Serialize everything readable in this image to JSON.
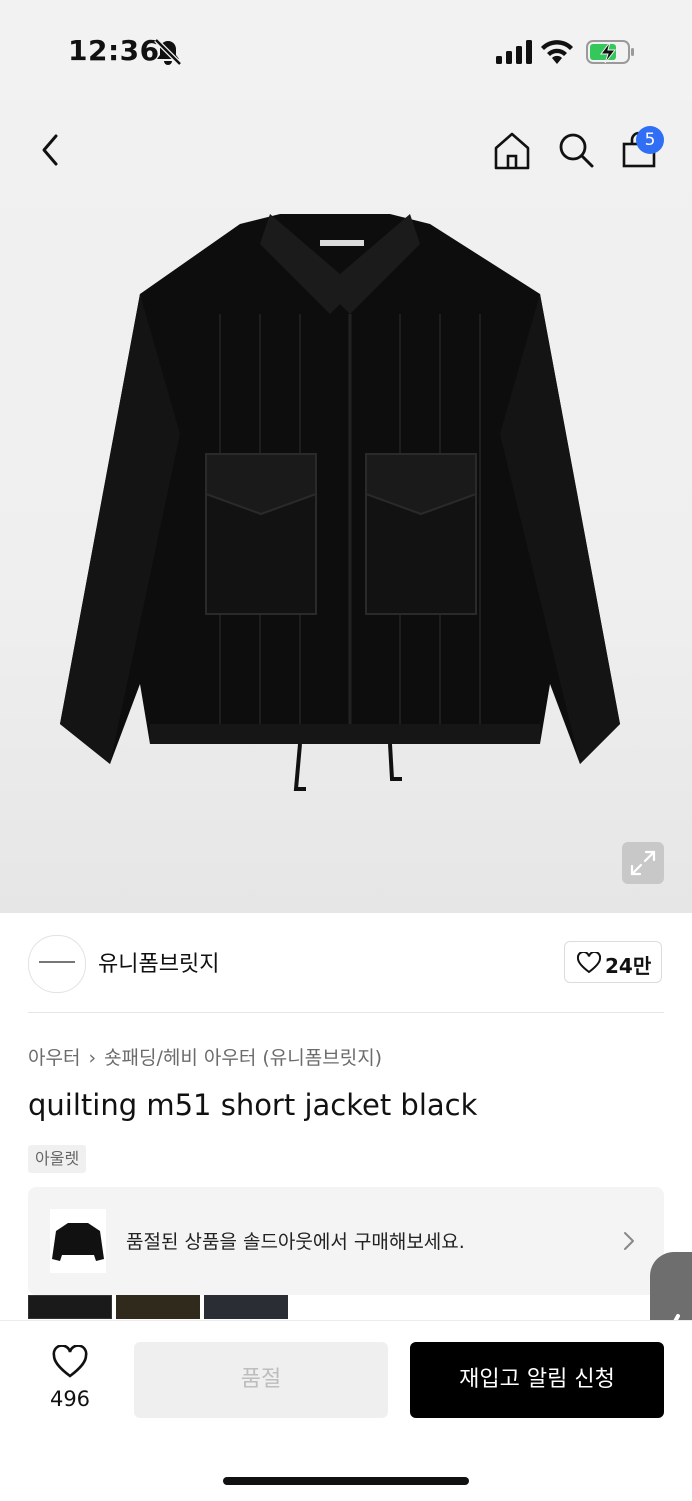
{
  "status_bar": {
    "time": "12:36",
    "icons": [
      "mute-icon",
      "signal-icon",
      "wifi-icon",
      "battery-charging-icon"
    ]
  },
  "header": {
    "back_icon": "chevron-left-icon",
    "home_icon": "home-icon",
    "search_icon": "search-icon",
    "bag_icon": "shopping-bag-icon",
    "bag_count": "5"
  },
  "brand": {
    "name": "유니폼브릿지",
    "likes": "24만"
  },
  "product": {
    "breadcrumb": [
      "아우터",
      "숏패딩/헤비 아우터 (유니폼브릿지)"
    ],
    "title": "quilting m51 short jacket black",
    "tag": "아울렛"
  },
  "soldout_banner": {
    "text": "품절된 상품을 솔드아웃에서 구매해보세요."
  },
  "bottom_bar": {
    "wish_count": "496",
    "soldout_label": "품절",
    "restock_label": "재입고 알림 신청"
  },
  "colors": {
    "badge": "#2f6ef5",
    "primary_button": "#000000",
    "disabled_button": "#efefef"
  }
}
